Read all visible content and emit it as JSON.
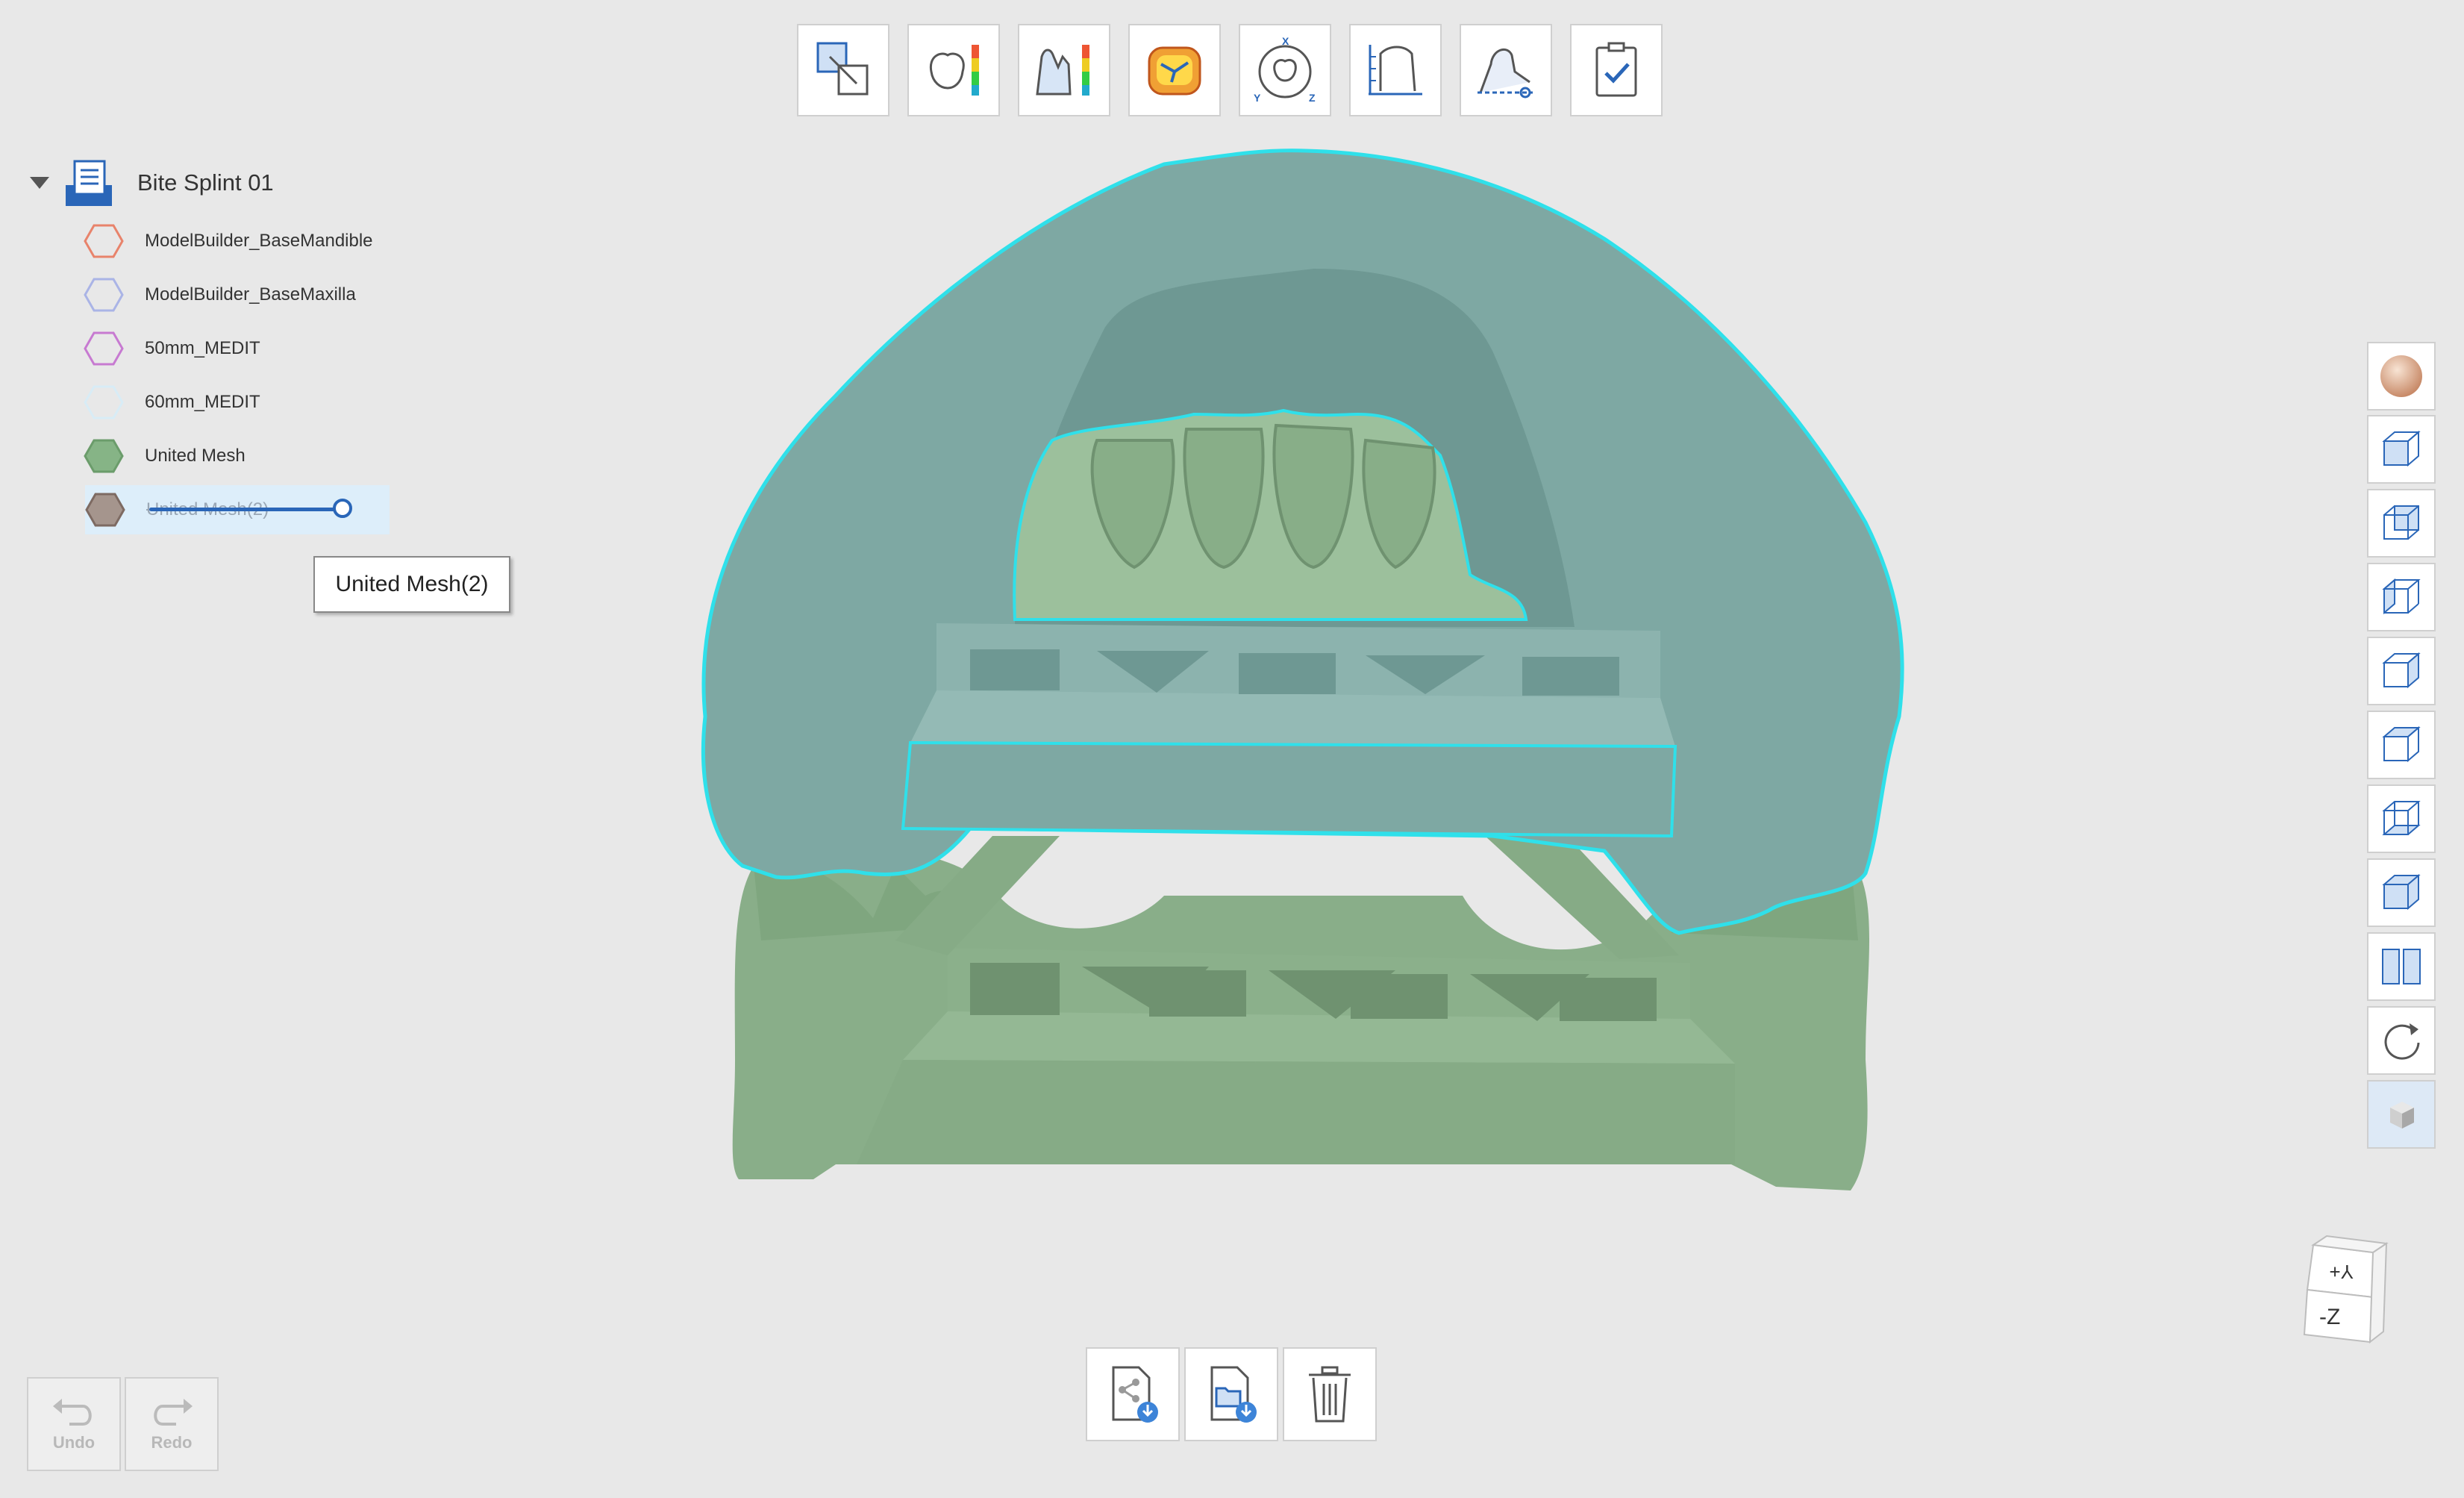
{
  "tree": {
    "root_label": "Bite Splint 01",
    "items": [
      {
        "label": "ModelBuilder_BaseMandible",
        "color": "#e8836b",
        "fill": "none"
      },
      {
        "label": "ModelBuilder_BaseMaxilla",
        "color": "#aab4e6",
        "fill": "none"
      },
      {
        "label": "50mm_MEDIT",
        "color": "#c77ad1",
        "fill": "none"
      },
      {
        "label": "60mm_MEDIT",
        "color": "#d8ecf6",
        "fill": "none"
      },
      {
        "label": "United Mesh",
        "color": "#6b9c6b",
        "fill": "#86b486"
      },
      {
        "label": "United Mesh(2)",
        "color": "#7d6a62",
        "fill": "#a5958d"
      }
    ],
    "tooltip": "United Mesh(2)"
  },
  "toolbar": {
    "tools": [
      "fit-icon",
      "thickness-map-icon",
      "deviation-map-icon",
      "occlusion-icon",
      "orientation-icon",
      "measure-icon",
      "cut-icon",
      "checklist-icon"
    ]
  },
  "view": {
    "tools": [
      "material-icon",
      "front-view-icon",
      "back-view-icon",
      "left-view-icon",
      "right-view-icon",
      "top-view-icon",
      "bottom-view-icon",
      "fit-view-icon",
      "split-view-icon",
      "rotate-icon",
      "perspective-icon"
    ]
  },
  "bottom": {
    "tools": [
      "export-icon",
      "open-file-icon",
      "delete-icon"
    ]
  },
  "history": {
    "undo_label": "Undo",
    "redo_label": "Redo"
  },
  "orientation_cube": {
    "top_label": "Y+",
    "front_label": "-Z"
  },
  "colors": {
    "splint": "#7ea8a3",
    "model": "#89ae89",
    "outline": "#2fe0ea",
    "accent": "#2a66b8"
  }
}
